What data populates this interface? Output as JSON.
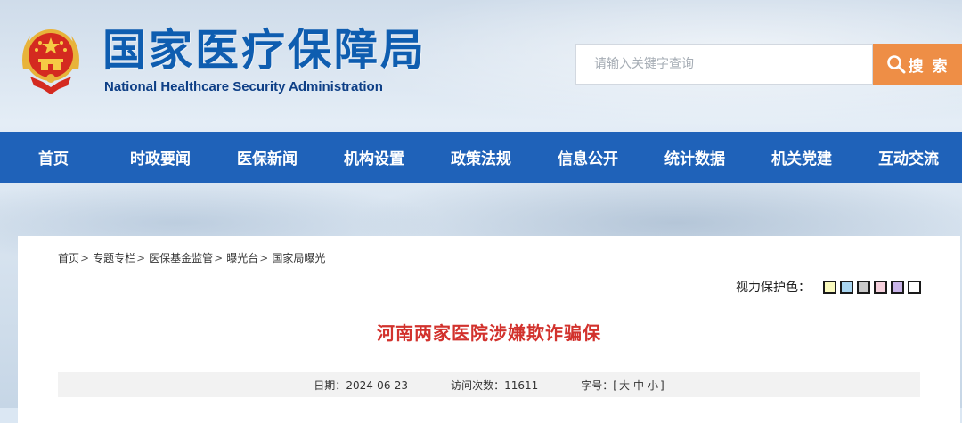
{
  "header": {
    "site_name_cn": "国家医疗保障局",
    "site_name_en": "National Healthcare Security Administration",
    "search": {
      "placeholder": "请输入关键字查询",
      "button_label": "搜 索"
    }
  },
  "nav": {
    "items": [
      "首页",
      "时政要闻",
      "医保新闻",
      "机构设置",
      "政策法规",
      "信息公开",
      "统计数据",
      "机关党建",
      "互动交流"
    ]
  },
  "breadcrumb": {
    "items": [
      "首页",
      "专题专栏",
      "医保基金监管",
      "曝光台",
      "国家局曝光"
    ],
    "separator": ">"
  },
  "eye_care": {
    "label": "视力保护色：",
    "colors": [
      "#fafabd",
      "#a9d5f0",
      "#c8c8c8",
      "#f5d0dc",
      "#c9b4e8",
      "#ffffff"
    ]
  },
  "article": {
    "title": "河南两家医院涉嫌欺诈骗保",
    "date_label": "日期：",
    "date": "2024-06-23",
    "visits_label": "访问次数：",
    "visits": "11611",
    "font_size_label": "字号：",
    "font_size_open": "[",
    "font_size_options": [
      "大",
      "中",
      "小"
    ],
    "font_size_close": "]"
  },
  "colors": {
    "nav_bg": "#1f62b9",
    "search_btn": "#ee8e46",
    "title": "#d2322d",
    "logo": "#0e5db0"
  }
}
